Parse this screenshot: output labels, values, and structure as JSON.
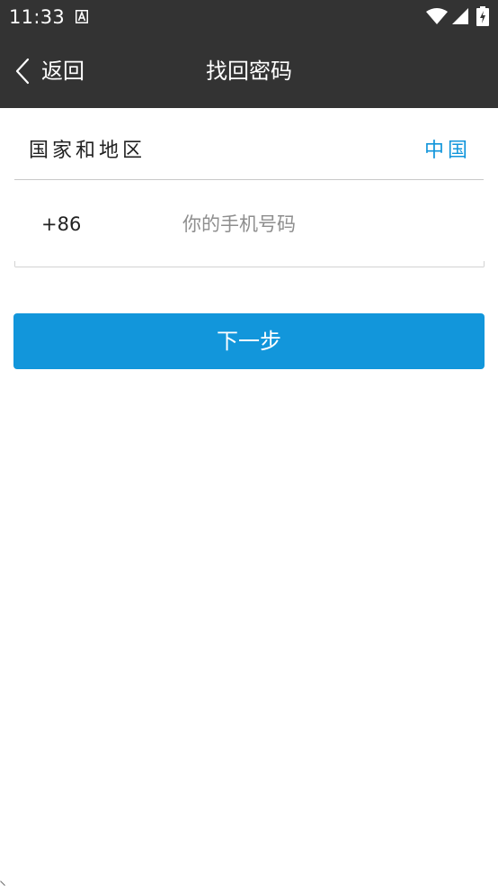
{
  "status_bar": {
    "time": "11:33",
    "icons": [
      "text-a-icon",
      "wifi-icon",
      "cell-signal-icon",
      "battery-charging-icon"
    ]
  },
  "toolbar": {
    "back_label": "返回",
    "title": "找回密码"
  },
  "region": {
    "label": "国家和地区",
    "value": "中国"
  },
  "phone": {
    "country_code": "+86",
    "value": "",
    "placeholder": "你的手机号码"
  },
  "actions": {
    "next_label": "下一步"
  },
  "colors": {
    "header_bg": "#333333",
    "accent": "#1296db",
    "divider": "#c9c9c9",
    "placeholder": "#8e8e8e"
  }
}
